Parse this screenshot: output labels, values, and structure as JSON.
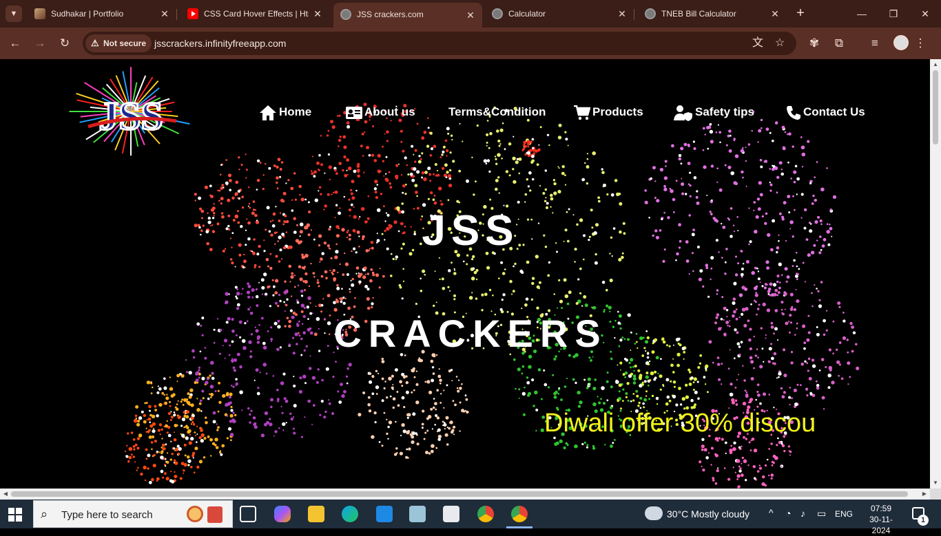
{
  "browser": {
    "tabs": [
      {
        "title": "Sudhakar | Portfolio",
        "icon": "portfolio-favicon",
        "active": false
      },
      {
        "title": "CSS Card Hover Effects | Htm",
        "icon": "youtube-favicon",
        "active": false
      },
      {
        "title": "JSS crackers.com",
        "icon": "globe-favicon",
        "active": true
      },
      {
        "title": "Calculator",
        "icon": "globe-favicon",
        "active": false
      },
      {
        "title": "TNEB Bill Calculator",
        "icon": "globe-favicon",
        "active": false
      }
    ],
    "security_chip": "Not secure",
    "url": "jsscrackers.infinityfreeapp.com"
  },
  "site": {
    "logo_text": "JSS",
    "nav": [
      {
        "label": "Home",
        "icon": "home-icon"
      },
      {
        "label": "About us",
        "icon": "id-card-icon"
      },
      {
        "label": "Terms&Condition",
        "icon": ""
      },
      {
        "label": "Products",
        "icon": "cart-icon"
      },
      {
        "label": "Safety tips",
        "icon": "user-shield-icon"
      },
      {
        "label": "Contact Us",
        "icon": "phone-icon"
      }
    ],
    "hero_line1": "JSS",
    "hero_line2": "CRACKERS",
    "marquee": "Diwali offer 30% discou"
  },
  "taskbar": {
    "search_placeholder": "Type here to search",
    "weather": "30°C  Mostly cloudy",
    "language": "ENG",
    "time": "07:59",
    "date": "30-11-2024",
    "notification_count": "1"
  },
  "colors": {
    "tabstrip": "#3a1e17",
    "toolbar": "#5a2f25",
    "marquee_text": "#f2f21a",
    "taskbar": "#1f2c3a"
  }
}
